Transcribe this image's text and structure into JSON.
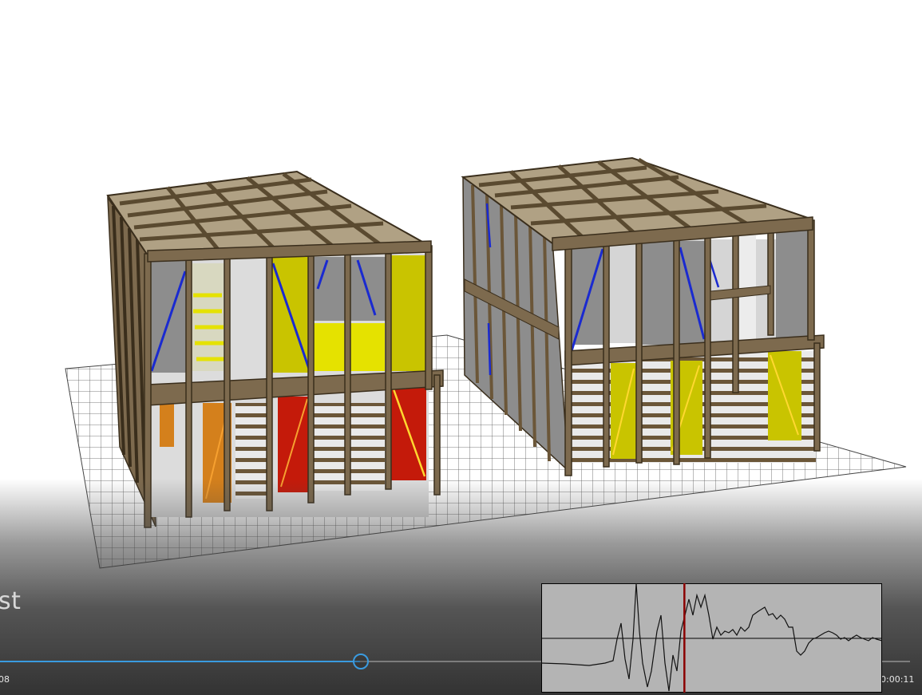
{
  "caption": "st",
  "player": {
    "current_time": "08",
    "total_time": "0:00:11",
    "progress_fraction": 0.39
  },
  "waveform": {
    "marker_fraction": 0.42
  },
  "colors": {
    "accent": "#3a9be0",
    "frame": "#6b5638",
    "panel_gray": "#8d8d8d",
    "panel_yellow": "#c9c400",
    "panel_red": "#c41a0a",
    "panel_orange": "#d4801c",
    "brace_blue": "#1a2ad0",
    "marker_red": "#8b0000"
  }
}
